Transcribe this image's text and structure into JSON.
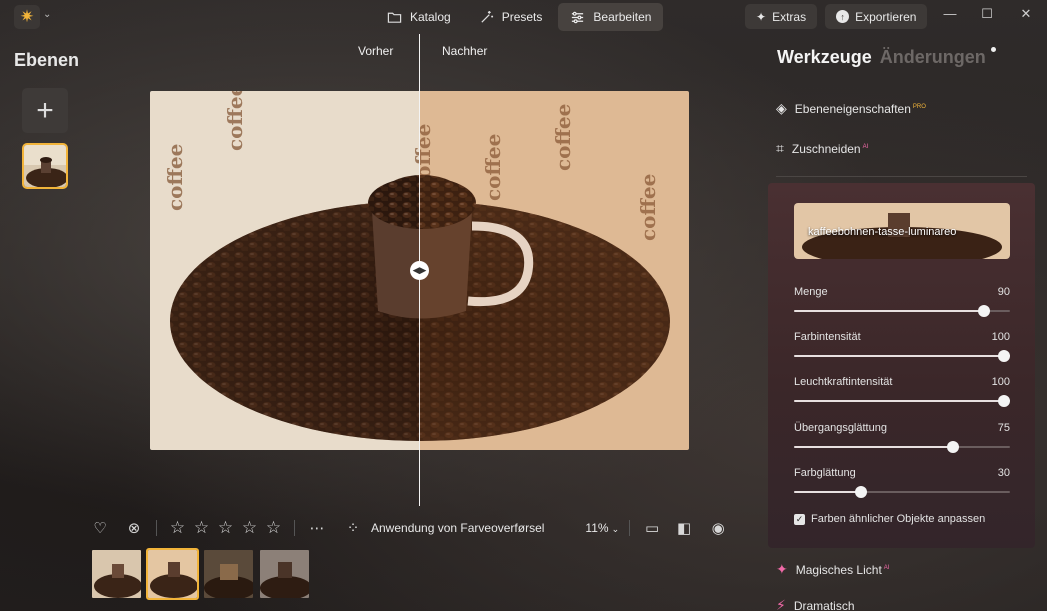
{
  "topbar": {
    "app_icon": "sun-logo-icon",
    "nav": [
      {
        "label": "Katalog",
        "icon": "folder-icon"
      },
      {
        "label": "Presets",
        "icon": "sparkle-wand-icon"
      },
      {
        "label": "Bearbeiten",
        "icon": "sliders-icon",
        "active": true
      }
    ],
    "extras_label": "Extras",
    "export_label": "Exportieren"
  },
  "left": {
    "title": "Ebenen",
    "add_symbol": "+"
  },
  "compare": {
    "before_label": "Vorher",
    "after_label": "Nachher",
    "photo_text": "coffee"
  },
  "bottombar": {
    "rating_stars": 5,
    "status_text": "Anwendung von Farveoverførsel",
    "zoom": "11%"
  },
  "right": {
    "tab_tools": "Werkzeuge",
    "tab_changes": "Änderungen",
    "tools": [
      {
        "label": "Ebeneneigenschaften",
        "badge": "PRO",
        "icon": "layers-icon"
      },
      {
        "label": "Zuschneiden",
        "badge": "AI",
        "icon": "crop-icon"
      }
    ],
    "preset_name": "kaffeebohnen-tasse-luminareo",
    "sliders": [
      {
        "label": "Menge",
        "value": 90,
        "fraction": 0.9
      },
      {
        "label": "Farbintensität",
        "value": 100,
        "fraction": 1.0
      },
      {
        "label": "Leuchtkraftintensität",
        "value": 100,
        "fraction": 1.0
      },
      {
        "label": "Übergangsglättung",
        "value": 75,
        "fraction": 0.75
      },
      {
        "label": "Farbglättung",
        "value": 30,
        "fraction": 0.3
      }
    ],
    "checkbox_label": "Farben ähnlicher Objekte anpassen",
    "checkbox_checked": true,
    "more_tools": [
      {
        "label": "Magisches Licht",
        "badge": "AI",
        "icon": "magic-sparkle-icon"
      },
      {
        "label": "Dramatisch",
        "icon": "lightning-icon"
      }
    ]
  },
  "colors": {
    "accent": "#f2b43a",
    "ai_pink": "#f06aa8"
  }
}
